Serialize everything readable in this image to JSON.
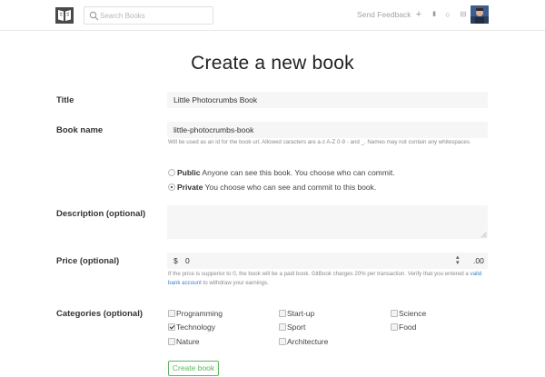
{
  "header": {
    "logo_icon": "gitbook-logo-icon",
    "search_placeholder": "Search Books",
    "feedback_label": "Send Feedback",
    "icons": [
      "plus-icon",
      "bell-icon",
      "circle-icon",
      "inbox-icon"
    ],
    "icon_glyphs": [
      "+",
      "▮",
      "○",
      "⊟"
    ]
  },
  "page": {
    "title": "Create a new book"
  },
  "form": {
    "title_label": "Title",
    "title_value": "Little Photocrumbs Book",
    "bookname_label": "Book name",
    "bookname_value": "little-photocrumbs-book",
    "bookname_help": "Will be used as an id for the book url. Allowed caracters are a-z A-Z 0-9 - and _. Names may not contain any whitespaces.",
    "visibility": {
      "public_title": "Public",
      "public_desc": "Anyone can see this book. You choose who can commit.",
      "private_title": "Private",
      "private_desc": "You choose who can see and commit to this book.",
      "selected": "Private"
    },
    "description_label": "Description (optional)",
    "description_value": "",
    "price_label": "Price (optional)",
    "price_currency": "$",
    "price_value": "0",
    "price_cents": ".00",
    "price_help_1": "If the price is supperior to 0, the book will be a paid book. GitBook charges 20% per transaction. Verify that you entered a",
    "price_help_link": "valid bank account",
    "price_help_2": "to withdraw your earnings.",
    "categories_label": "Categories (optional)",
    "categories": [
      {
        "label": "Programming",
        "checked": false
      },
      {
        "label": "Start-up",
        "checked": false
      },
      {
        "label": "Science",
        "checked": false
      },
      {
        "label": "Technology",
        "checked": true
      },
      {
        "label": "Sport",
        "checked": false
      },
      {
        "label": "Food",
        "checked": false
      },
      {
        "label": "Nature",
        "checked": false
      },
      {
        "label": "Architecture",
        "checked": false
      }
    ],
    "submit_label": "Create book"
  },
  "colors": {
    "accent": "#5cb85c",
    "link": "#4183c4",
    "field_bg": "#f6f6f6"
  }
}
